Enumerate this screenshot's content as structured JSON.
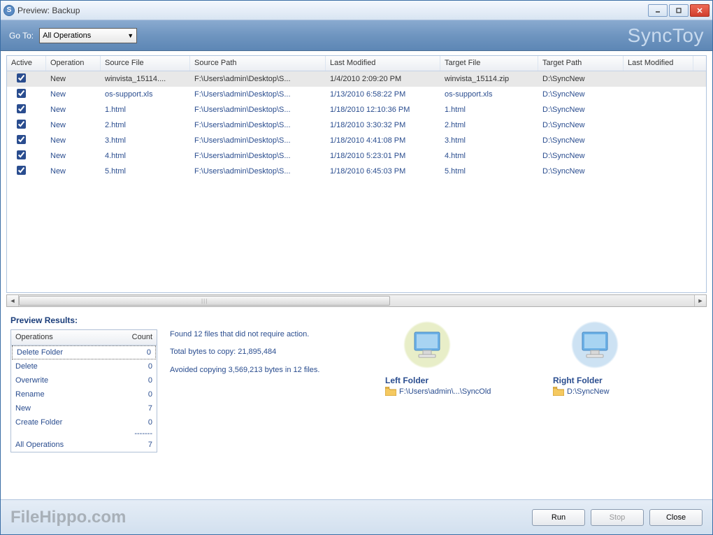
{
  "titlebar": {
    "title": "Preview: Backup"
  },
  "toolbar": {
    "goto_label": "Go To:",
    "goto_value": "All Operations",
    "brand": "SyncToy"
  },
  "columns": {
    "active": "Active",
    "operation": "Operation",
    "source_file": "Source File",
    "source_path": "Source Path",
    "last_modified": "Last Modified",
    "target_file": "Target File",
    "target_path": "Target Path",
    "last_modified2": "Last Modified"
  },
  "rows": [
    {
      "active": true,
      "operation": "New",
      "source_file": "winvista_15114....",
      "source_path": "F:\\Users\\admin\\Desktop\\S...",
      "last_modified": "1/4/2010 2:09:20 PM",
      "target_file": "winvista_15114.zip",
      "target_path": "D:\\SyncNew",
      "selected": true
    },
    {
      "active": true,
      "operation": "New",
      "source_file": "os-support.xls",
      "source_path": "F:\\Users\\admin\\Desktop\\S...",
      "last_modified": "1/13/2010 6:58:22 PM",
      "target_file": "os-support.xls",
      "target_path": "D:\\SyncNew",
      "selected": false
    },
    {
      "active": true,
      "operation": "New",
      "source_file": "1.html",
      "source_path": "F:\\Users\\admin\\Desktop\\S...",
      "last_modified": "1/18/2010 12:10:36 PM",
      "target_file": "1.html",
      "target_path": "D:\\SyncNew",
      "selected": false
    },
    {
      "active": true,
      "operation": "New",
      "source_file": "2.html",
      "source_path": "F:\\Users\\admin\\Desktop\\S...",
      "last_modified": "1/18/2010 3:30:32 PM",
      "target_file": "2.html",
      "target_path": "D:\\SyncNew",
      "selected": false
    },
    {
      "active": true,
      "operation": "New",
      "source_file": "3.html",
      "source_path": "F:\\Users\\admin\\Desktop\\S...",
      "last_modified": "1/18/2010 4:41:08 PM",
      "target_file": "3.html",
      "target_path": "D:\\SyncNew",
      "selected": false
    },
    {
      "active": true,
      "operation": "New",
      "source_file": "4.html",
      "source_path": "F:\\Users\\admin\\Desktop\\S...",
      "last_modified": "1/18/2010 5:23:01 PM",
      "target_file": "4.html",
      "target_path": "D:\\SyncNew",
      "selected": false
    },
    {
      "active": true,
      "operation": "New",
      "source_file": "5.html",
      "source_path": "F:\\Users\\admin\\Desktop\\S...",
      "last_modified": "1/18/2010 6:45:03 PM",
      "target_file": "5.html",
      "target_path": "D:\\SyncNew",
      "selected": false
    }
  ],
  "results": {
    "title": "Preview Results:",
    "ops_header_label": "Operations",
    "ops_header_count": "Count",
    "operations": [
      {
        "label": "Delete Folder",
        "count": "0",
        "selected": true
      },
      {
        "label": "Delete",
        "count": "0",
        "selected": false
      },
      {
        "label": "Overwrite",
        "count": "0",
        "selected": false
      },
      {
        "label": "Rename",
        "count": "0",
        "selected": false
      },
      {
        "label": "New",
        "count": "7",
        "selected": false
      },
      {
        "label": "Create Folder",
        "count": "0",
        "selected": false
      }
    ],
    "divider": "-------",
    "all_ops_label": "All Operations",
    "all_ops_count": "7",
    "summary": {
      "line1": "Found 12 files that did not require action.",
      "line2": "Total bytes to copy: 21,895,484",
      "line3": "Avoided copying 3,569,213 bytes in 12 files."
    },
    "left_folder": {
      "title": "Left Folder",
      "path": "F:\\Users\\admin\\...\\SyncOld"
    },
    "right_folder": {
      "title": "Right Folder",
      "path": "D:\\SyncNew"
    }
  },
  "footer": {
    "watermark": "FileHippo.com",
    "run": "Run",
    "stop": "Stop",
    "close": "Close"
  }
}
